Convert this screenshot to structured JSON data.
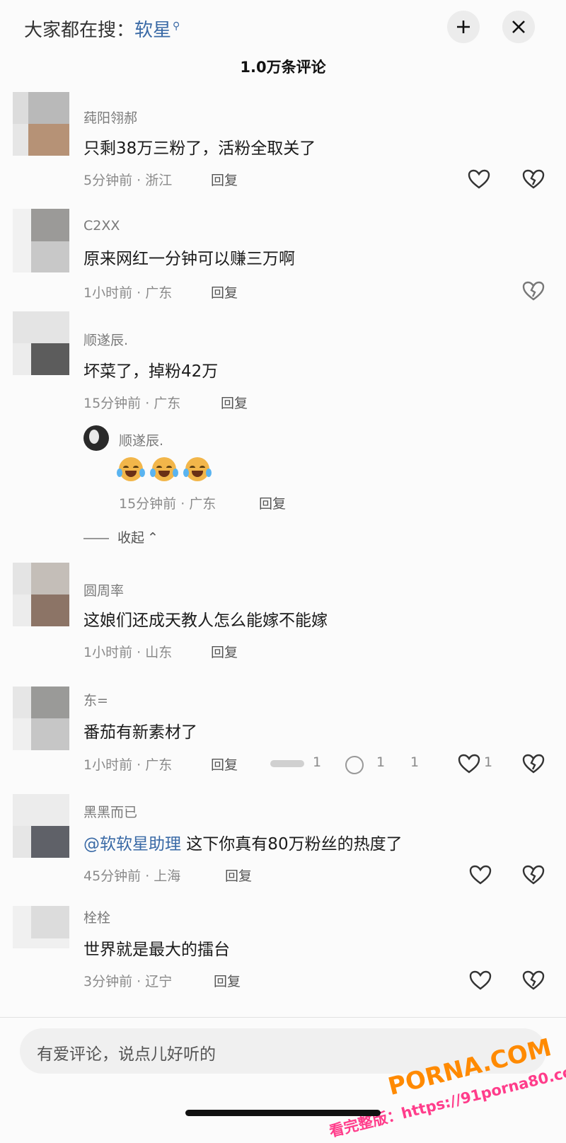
{
  "header": {
    "search_prefix": "大家都在搜：",
    "search_keyword": "软星",
    "comment_count_title": "1.0万条评论"
  },
  "comments": [
    {
      "name": "莼阳翎郝",
      "text": "只剩38万三粉了，活粉全取关了",
      "time_loc": "5分钟前 · 浙江",
      "reply": "回复"
    },
    {
      "name": "C2XX",
      "text": "原来网红一分钟可以赚三万啊",
      "time_loc": "1小时前 · 广东",
      "reply": "回复"
    },
    {
      "name": "顺遂辰.",
      "text": "坏菜了，掉粉42万",
      "time_loc": "15分钟前 · 广东",
      "reply": "回复"
    },
    {
      "name": "圆周率",
      "text": "这娘们还成天教人怎么能嫁不能嫁",
      "time_loc": "1小时前 · 山东",
      "reply": "回复"
    },
    {
      "name": "东=",
      "text": "番茄有新素材了",
      "time_loc": "1小时前 · 广东",
      "reply": "回复",
      "extra_counts": [
        "1",
        "1",
        "1"
      ],
      "like_count": "1"
    },
    {
      "name": "黑黑而已",
      "mention": "@软软星助理",
      "text": " 这下你真有80万粉丝的热度了",
      "time_loc": "45分钟前 · 上海",
      "reply": "回复"
    },
    {
      "name": "栓栓",
      "text": "世界就是最大的擂台",
      "time_loc": "3分钟前 · 辽宁",
      "reply": "回复"
    }
  ],
  "sub_reply": {
    "name": "顺遂辰.",
    "emojis": [
      "laugh-cry-emoji",
      "laugh-cry-emoji",
      "laugh-cry-emoji"
    ],
    "time_loc": "15分钟前 · 广东",
    "reply": "回复"
  },
  "collapse_label": "收起",
  "input": {
    "placeholder": "有爱评论，说点儿好听的"
  },
  "watermark": {
    "logo": "PORNA.COM",
    "url": "看完整版：https://91porna80.com"
  },
  "colors": {
    "accent": "#3a6aa6",
    "background": "#fbfbfb",
    "watermark_orange": "#ff8a00",
    "watermark_pink": "#ff3d8b"
  }
}
